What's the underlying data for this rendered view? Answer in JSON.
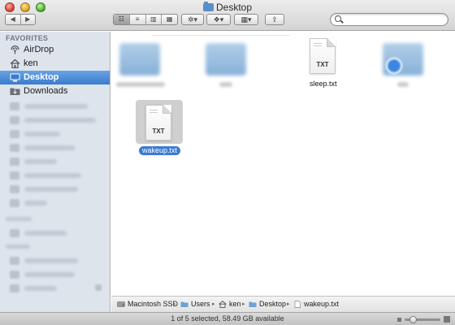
{
  "window": {
    "title": "Desktop",
    "controls": {
      "close": "close-icon",
      "minimize": "minimize-icon",
      "zoom": "zoom-icon"
    }
  },
  "toolbar": {
    "back_glyph": "◀",
    "forward_glyph": "▶",
    "view_modes": [
      "☷",
      "≡",
      "▥",
      "▦"
    ],
    "active_view": 0,
    "action_glyph": "✲▾",
    "dropbox_glyph": "❖▾",
    "arrange_glyph": "▦▾",
    "share_glyph": "⇪"
  },
  "search": {
    "placeholder": "",
    "value": ""
  },
  "sidebar": {
    "favorites_header": "FAVORITES",
    "items": [
      {
        "label": "AirDrop",
        "icon": "airdrop-icon",
        "selected": false
      },
      {
        "label": "ken",
        "icon": "home-icon",
        "selected": false
      },
      {
        "label": "Desktop",
        "icon": "desktop-icon",
        "selected": true
      },
      {
        "label": "Downloads",
        "icon": "downloads-icon",
        "selected": false
      }
    ]
  },
  "files": [
    {
      "name": "sleep.txt",
      "ext": "TXT",
      "selected": false
    },
    {
      "name": "wakeup.txt",
      "ext": "TXT",
      "selected": true
    }
  ],
  "pathbar": {
    "crumbs": [
      {
        "label": "Macintosh SSD",
        "icon": "hard-drive-icon"
      },
      {
        "label": "Users",
        "icon": "folder-icon"
      },
      {
        "label": "ken",
        "icon": "home-icon"
      },
      {
        "label": "Desktop",
        "icon": "folder-icon"
      },
      {
        "label": "wakeup.txt",
        "icon": "document-icon"
      }
    ],
    "separator": "▸"
  },
  "status": {
    "text": "1 of 5 selected, 58.49 GB available"
  },
  "colors": {
    "selection": "#3a7bd5",
    "sidebar_bg": "#dde4ec",
    "sidebar_selected": "#4a88d8"
  }
}
